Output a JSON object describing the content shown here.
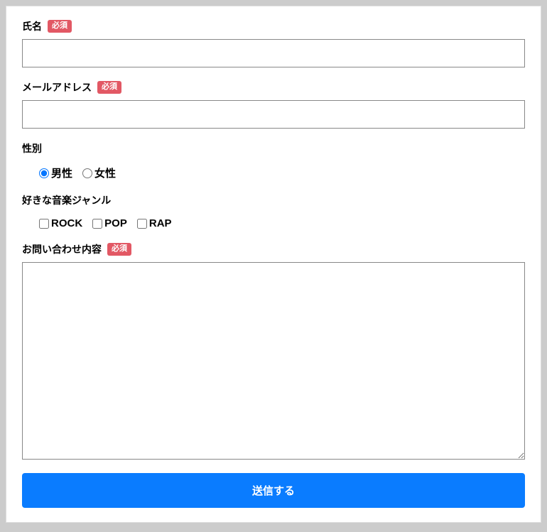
{
  "required_badge": "必須",
  "fields": {
    "name": {
      "label": "氏名",
      "required": true,
      "value": ""
    },
    "email": {
      "label": "メールアドレス",
      "required": true,
      "value": ""
    },
    "gender": {
      "label": "性別",
      "required": false,
      "options": [
        {
          "label": "男性",
          "value": "male",
          "checked": true
        },
        {
          "label": "女性",
          "value": "female",
          "checked": false
        }
      ]
    },
    "genre": {
      "label": "好きな音楽ジャンル",
      "required": false,
      "options": [
        {
          "label": "ROCK",
          "checked": false
        },
        {
          "label": "POP",
          "checked": false
        },
        {
          "label": "RAP",
          "checked": false
        }
      ]
    },
    "message": {
      "label": "お問い合わせ内容",
      "required": true,
      "value": ""
    }
  },
  "submit_label": "送信する"
}
